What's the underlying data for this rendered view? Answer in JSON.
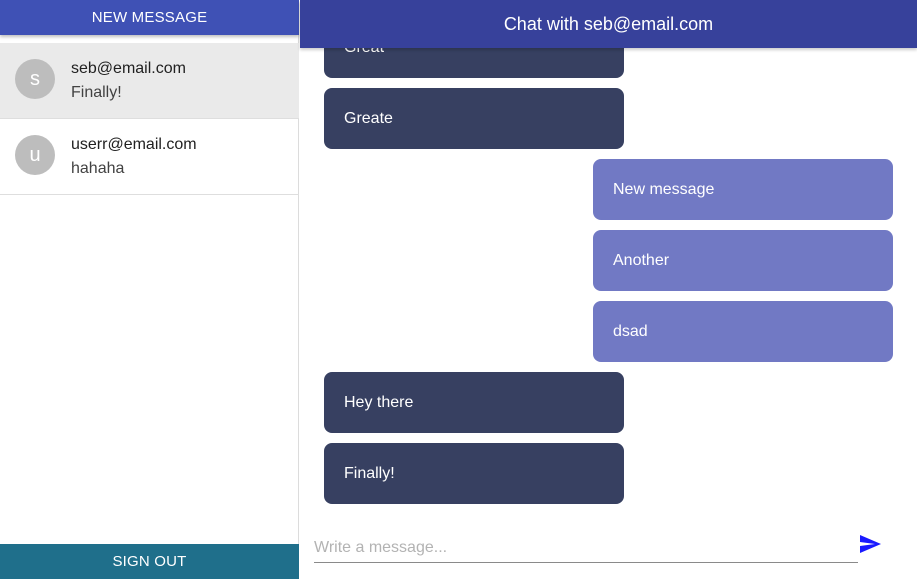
{
  "sidebar": {
    "new_message_label": "NEW MESSAGE",
    "sign_out_label": "SIGN OUT",
    "conversations": [
      {
        "initial": "s",
        "email": "seb@email.com",
        "preview": "Finally!",
        "active": true
      },
      {
        "initial": "u",
        "email": "userr@email.com",
        "preview": "hahaha",
        "active": false
      }
    ]
  },
  "chat": {
    "title": "Chat with seb@email.com",
    "messages": [
      {
        "text": "Great",
        "direction": "received"
      },
      {
        "text": "Greate",
        "direction": "received"
      },
      {
        "text": "New message",
        "direction": "sent"
      },
      {
        "text": "Another",
        "direction": "sent"
      },
      {
        "text": "dsad",
        "direction": "sent"
      },
      {
        "text": "Hey there",
        "direction": "received"
      },
      {
        "text": "Finally!",
        "direction": "received"
      }
    ],
    "composer": {
      "placeholder": "Write a message...",
      "value": "",
      "send_icon": "send-icon"
    }
  },
  "colors": {
    "primary": "#3f51b5",
    "header": "#37419b",
    "sign_out": "#1f6f8b",
    "received_bubble": "#374061",
    "sent_bubble": "#7179c4",
    "send_icon": "#1a1aff"
  }
}
